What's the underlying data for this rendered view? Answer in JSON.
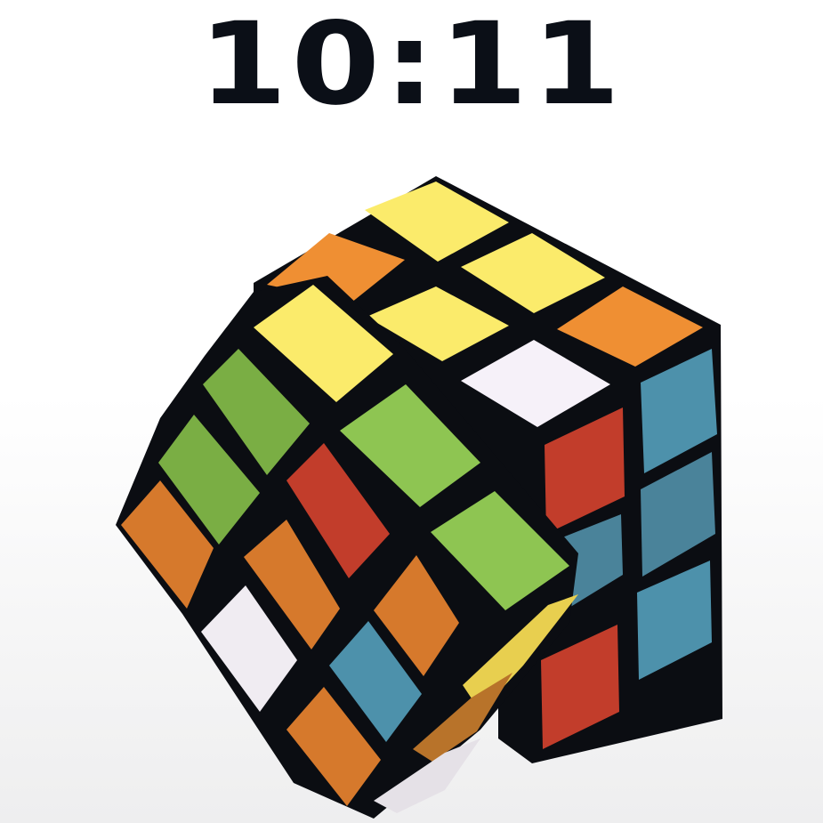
{
  "game": {
    "timer_text": "10:11"
  },
  "colors": {
    "body": "#0b0d12",
    "yellow": "#fbeb6b",
    "orange": "#ef8f33",
    "orange_dark": "#d6792c",
    "white": "#f6f1f9",
    "green": "#8ec552",
    "green_dark": "#7aae44",
    "red": "#c23d2b",
    "blue": "#4d91ab",
    "blue_dark": "#4a839a"
  },
  "cube": {
    "back_block": {
      "top": [
        [
          "orange",
          "yellow",
          "yellow"
        ],
        [
          "orange",
          "yellow",
          "yellow"
        ],
        [
          "yellow",
          "white",
          "orange"
        ]
      ],
      "right_upper": [
        "blue",
        "blue"
      ],
      "right_lower": [
        "blue",
        "blue"
      ],
      "front_visible": [
        "red",
        "red"
      ]
    },
    "rotated_layer": {
      "top": [
        [
          "yellow",
          "green",
          "green"
        ],
        [
          "green",
          "red",
          "green"
        ],
        [
          "orange",
          "orange",
          "orange"
        ]
      ],
      "front": [
        [
          "orange",
          "white",
          "orange"
        ],
        [
          "white",
          "blue",
          "orange"
        ],
        [
          "orange",
          "orange",
          "yellow"
        ]
      ]
    }
  }
}
